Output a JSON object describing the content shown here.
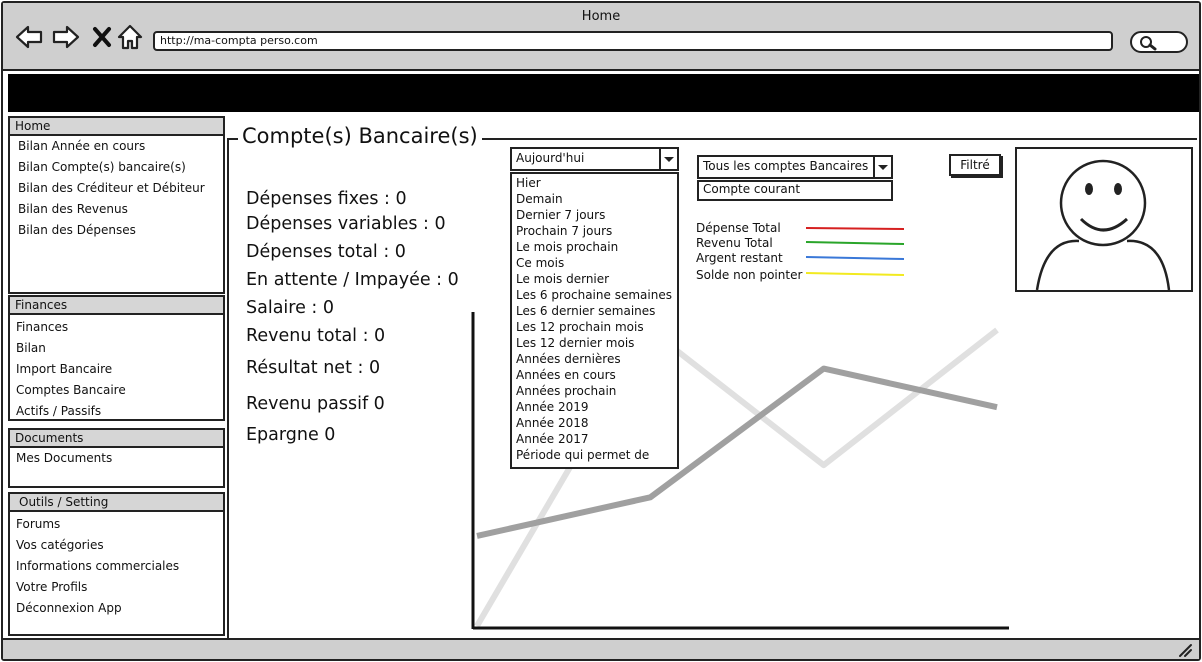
{
  "window": {
    "title": "Home"
  },
  "browser": {
    "url": "http://ma-compta perso.com"
  },
  "sidebar": {
    "panels": [
      {
        "header": "Home",
        "items": [
          "Bilan Année en cours",
          "Bilan Compte(s) bancaire(s)",
          "Bilan des Créditeur et Débiteur",
          "Bilan des Revenus",
          "Bilan des Dépenses"
        ]
      },
      {
        "header": "Finances",
        "items": [
          "Finances",
          "Bilan",
          "Import Bancaire",
          "Comptes Bancaire",
          "Actifs / Passifs"
        ]
      },
      {
        "header": "Documents",
        "items": [
          "Mes Documents"
        ]
      },
      {
        "header": "Outils / Setting",
        "items": [
          "Forums",
          "Vos catégories",
          "Informations commerciales",
          "Votre Profils",
          "Déconnexion App"
        ]
      }
    ]
  },
  "main": {
    "title": "Compte(s) Bancaire(s)",
    "stats": [
      "Dépenses fixes : 0",
      "Dépenses variables : 0",
      "Dépenses total : 0",
      "En attente / Impayée : 0",
      "Salaire : 0",
      "Revenu total : 0",
      "Résultat net : 0",
      "Revenu passif 0",
      "Epargne 0"
    ]
  },
  "period_select": {
    "selected": "Aujourd'hui",
    "options": [
      "Hier",
      "Demain",
      "Dernier 7 jours",
      "Prochain 7 jours",
      "Le mois prochain",
      "Ce mois",
      "Le mois dernier",
      "Les 6 prochaine semaines",
      "Les 6 dernier semaines",
      "Les 12 prochain mois",
      "Les 12 dernier mois",
      "Années dernières",
      "Années en cours",
      "Années prochain",
      "Année 2019",
      "Année 2018",
      "Année 2017",
      "Période qui permet de"
    ]
  },
  "account_select": {
    "selected": "Tous les comptes Bancaires",
    "sub_option": "Compte courant"
  },
  "filter_button": {
    "label": "Filtré"
  },
  "legend": [
    {
      "label": "Dépense Total",
      "color": "#d62020"
    },
    {
      "label": "Revenu Total",
      "color": "#2aa52a"
    },
    {
      "label": "Argent restant",
      "color": "#3a78d8"
    },
    {
      "label": "Solde non pointer",
      "color": "#f2ea20"
    }
  ],
  "chart_data": {
    "type": "line",
    "series": [
      {
        "color": "#e0e0e0",
        "points": [
          [
            0,
            0
          ],
          [
            1,
            4.6
          ],
          [
            2,
            2.5
          ],
          [
            3,
            4.6
          ]
        ]
      },
      {
        "color": "#a0a0a0",
        "points": [
          [
            0,
            1.4
          ],
          [
            1,
            2.0
          ],
          [
            2,
            4.0
          ],
          [
            3,
            3.4
          ]
        ]
      }
    ]
  },
  "icons": [
    "back-arrow-icon",
    "forward-arrow-icon",
    "close-icon",
    "home-icon",
    "search-icon",
    "smiley-avatar-icon",
    "resize-grip-icon"
  ]
}
